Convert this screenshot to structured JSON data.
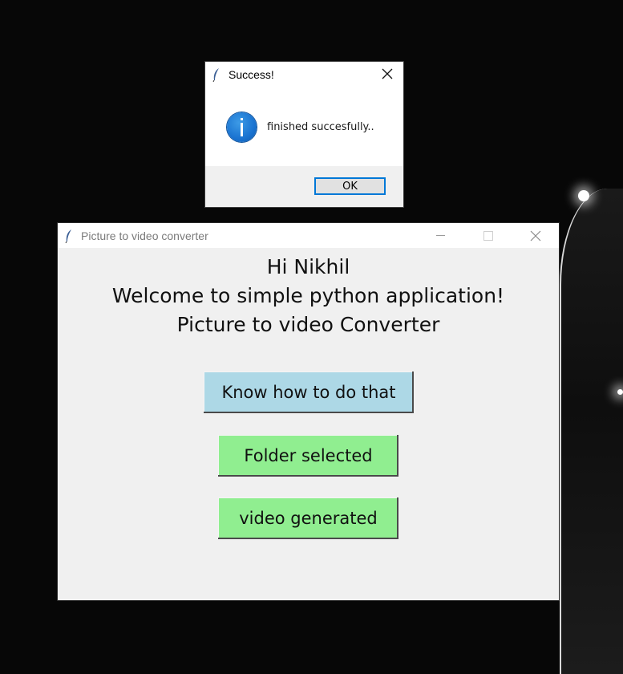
{
  "main_window": {
    "title": "Picture to video converter",
    "greeting": "Hi Nikhil",
    "welcome": "Welcome to simple python application!",
    "app_name": "Picture to video Converter",
    "buttons": {
      "how_to": "Know how to do that",
      "folder": "Folder selected",
      "video": "video generated"
    },
    "colors": {
      "how_to_bg": "#add8e6",
      "action_bg": "#90ee90"
    }
  },
  "dialog": {
    "title": "Success!",
    "message": "finished succesfully..",
    "ok_label": "OK",
    "icon": "info-icon"
  }
}
